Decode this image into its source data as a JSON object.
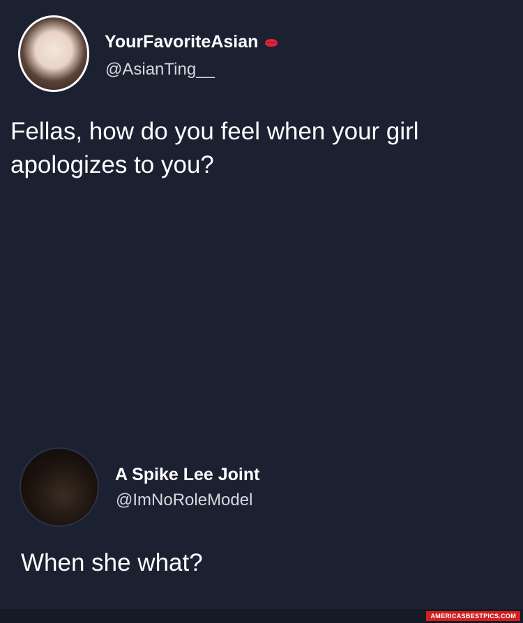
{
  "tweets": [
    {
      "display_name": "YourFavoriteAsian",
      "badge_icon": "lips-icon",
      "handle": "@AsianTing__",
      "text": "Fellas, how do you feel when your girl apologizes to you?"
    },
    {
      "display_name": "A Spike Lee Joint",
      "handle": "@ImNoRoleModel",
      "text": "When she what?"
    }
  ],
  "watermark": "AMERICASBESTPICS.COM",
  "colors": {
    "background": "#1c2132",
    "text": "#ffffff",
    "handle": "#d6d8de",
    "badge": "#e0243b"
  }
}
